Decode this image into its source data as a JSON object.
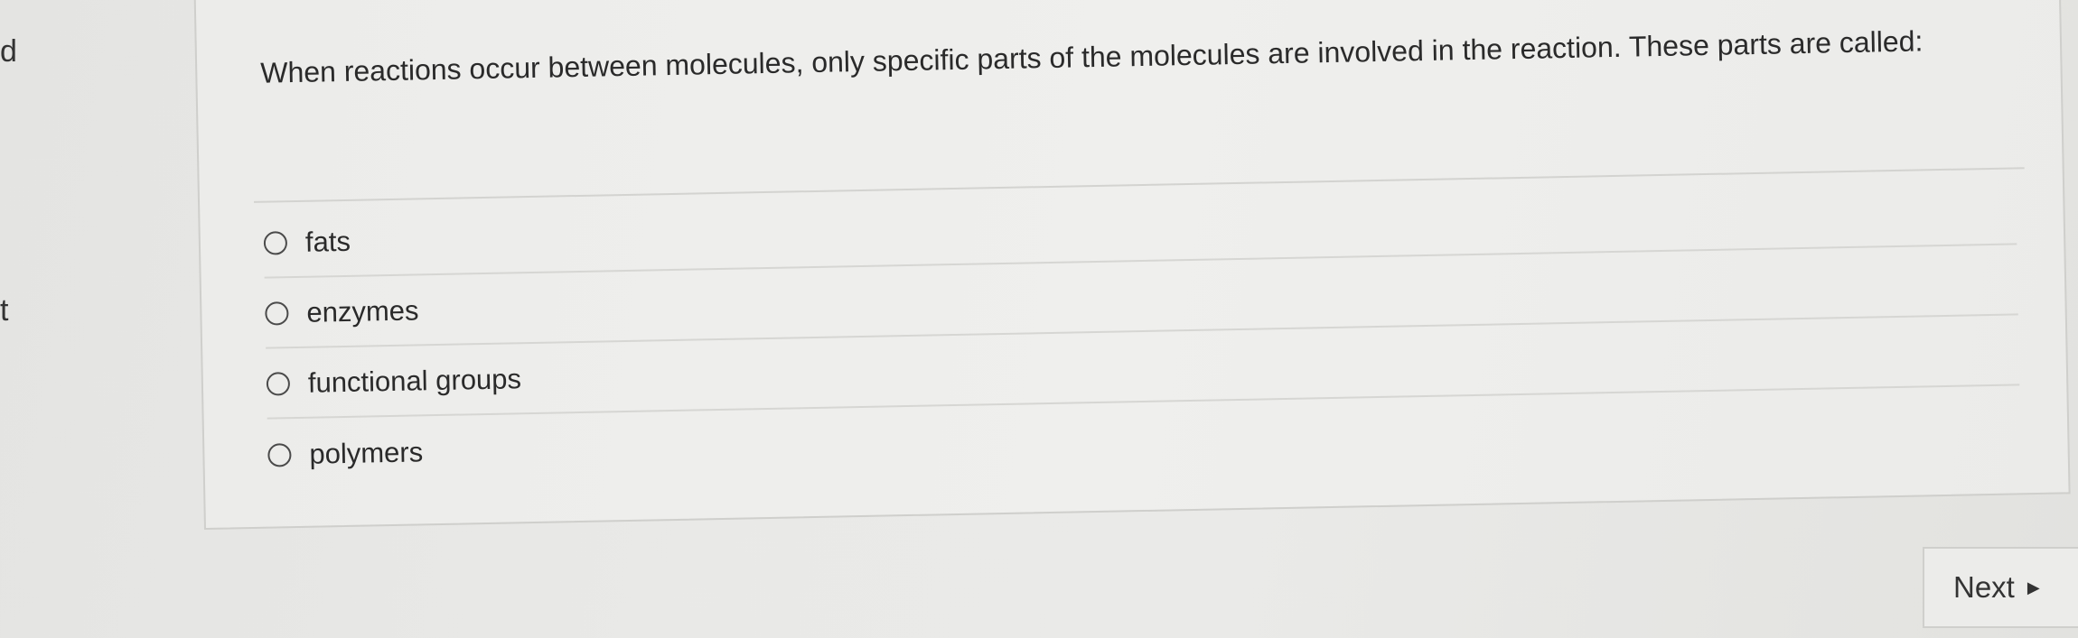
{
  "edge_text": {
    "top": "d",
    "middle": "t"
  },
  "question": {
    "text": "When reactions occur between molecules, only specific parts of the molecules are involved in the reaction. These parts are called:",
    "options": [
      {
        "label": "fats"
      },
      {
        "label": "enzymes"
      },
      {
        "label": "functional groups"
      },
      {
        "label": "polymers"
      }
    ]
  },
  "navigation": {
    "next_label": "Next",
    "next_icon": "triangle-right-icon"
  }
}
